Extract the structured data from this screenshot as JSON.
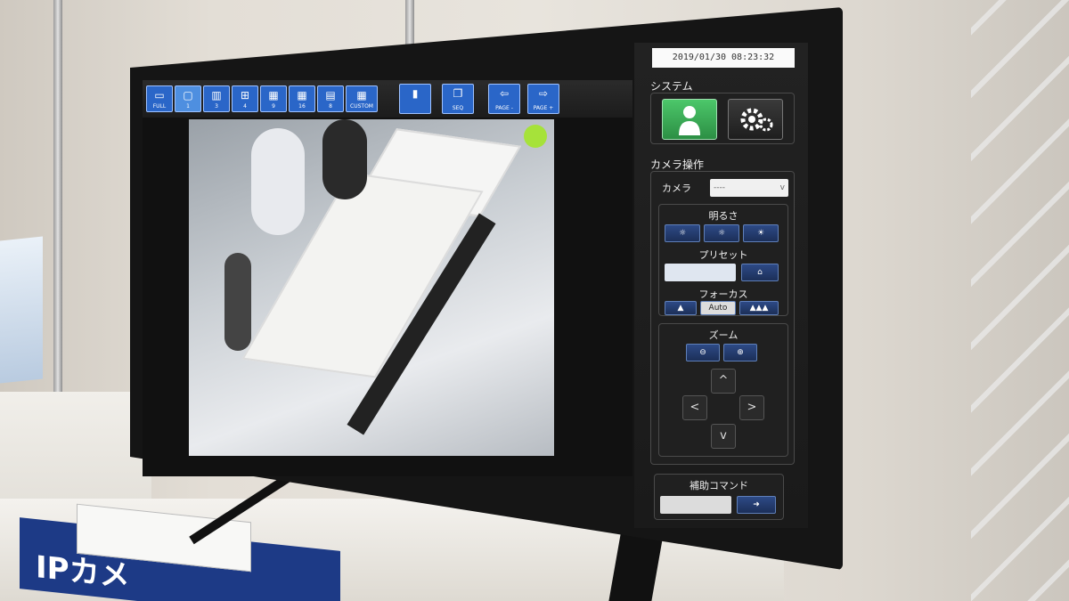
{
  "toolbar": {
    "buttons": [
      {
        "label": "FULL"
      },
      {
        "label": "1"
      },
      {
        "label": "3"
      },
      {
        "label": "4"
      },
      {
        "label": "9"
      },
      {
        "label": "16"
      },
      {
        "label": "8"
      },
      {
        "label": "CUSTOM"
      }
    ],
    "seq_label": "SEQ",
    "page_prev_label": "PAGE -",
    "page_next_label": "PAGE +"
  },
  "datetime": "2019/01/30 08:23:32",
  "system": {
    "title": "システム"
  },
  "camera_ops": {
    "title": "カメラ操作",
    "camera_label": "カメラ",
    "camera_value": "----",
    "brightness_label": "明るさ",
    "preset_label": "プリセット",
    "focus_label": "フォーカス",
    "focus_auto": "Auto",
    "zoom_label": "ズーム",
    "aux_label": "補助コマンド"
  },
  "sign": {
    "text": "IPカメ"
  },
  "colors": {
    "toolbar_button": "#2a66c8",
    "user_button": "#3aa857",
    "indicator": "#a6e23a"
  }
}
